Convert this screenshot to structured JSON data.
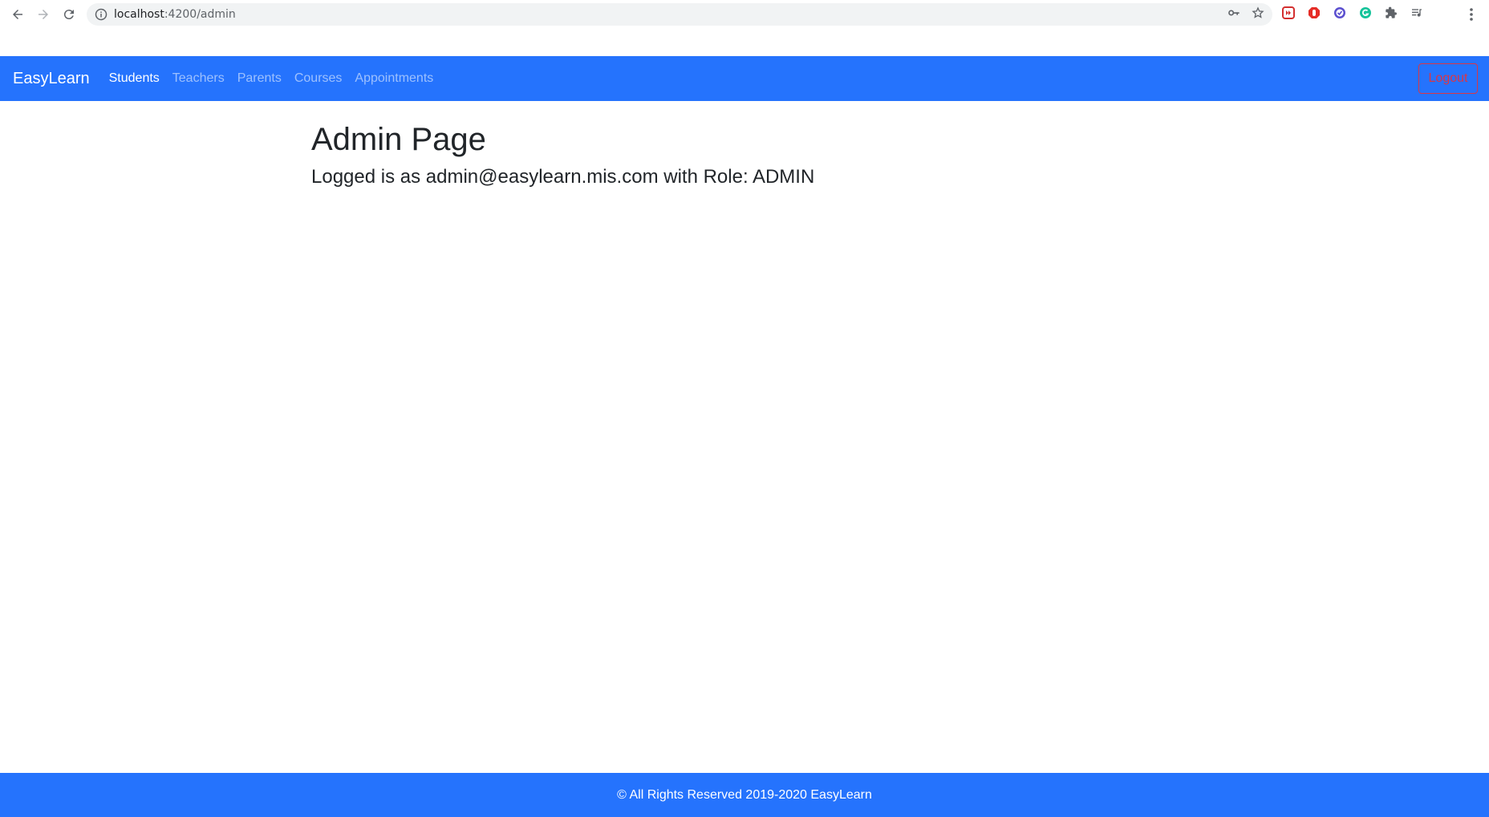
{
  "browser": {
    "url_host": "localhost",
    "url_path": ":4200/admin"
  },
  "navbar": {
    "brand": "EasyLearn",
    "links": [
      {
        "label": "Students"
      },
      {
        "label": "Teachers"
      },
      {
        "label": "Parents"
      },
      {
        "label": "Courses"
      },
      {
        "label": "Appointments"
      }
    ],
    "logout_label": "Logout"
  },
  "main": {
    "title": "Admin Page",
    "login_info": "Logged is as admin@easylearn.mis.com with Role: ADMIN"
  },
  "footer": {
    "text": "© All Rights Reserved 2019-2020 EasyLearn"
  },
  "colors": {
    "navbar_bg": "#2573fd",
    "logout_red": "#dc3545"
  }
}
